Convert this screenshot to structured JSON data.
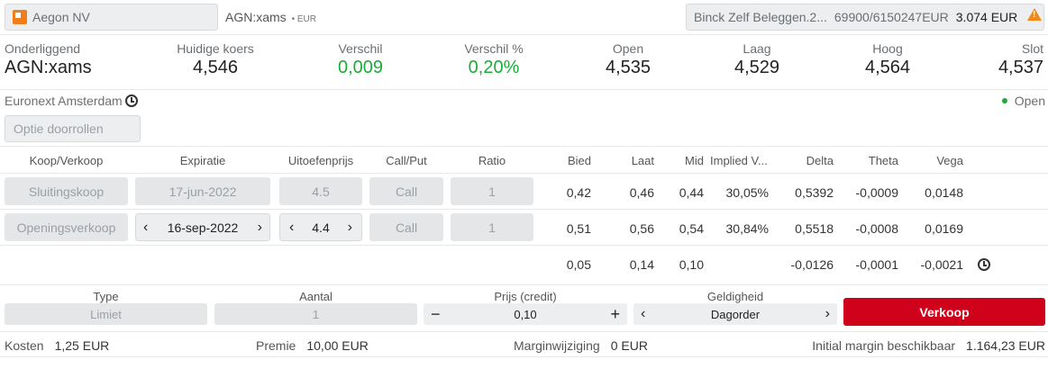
{
  "top": {
    "instrument": "Aegon NV",
    "symbol": "AGN:xams",
    "symbol_ccy": "• EUR",
    "account_name": "Binck Zelf Beleggen.2...",
    "account_no": "69900/6150247EUR",
    "account_amount": "3.074 EUR"
  },
  "quote": [
    {
      "label": "Onderliggend",
      "value": "AGN:xams",
      "color": "#222222"
    },
    {
      "label": "Huidige koers",
      "value": "4,546",
      "color": "#222222"
    },
    {
      "label": "Verschil",
      "value": "0,009",
      "color": "#1eab3a"
    },
    {
      "label": "Verschil %",
      "value": "0,20%",
      "color": "#1eab3a"
    },
    {
      "label": "Open",
      "value": "4,535",
      "color": "#222222"
    },
    {
      "label": "Laag",
      "value": "4,529",
      "color": "#222222"
    },
    {
      "label": "Hoog",
      "value": "4,564",
      "color": "#222222"
    },
    {
      "label": "Slot",
      "value": "4,537",
      "color": "#222222"
    }
  ],
  "exchange": "Euronext Amsterdam",
  "market_status": "Open",
  "rollover_label": "Optie doorrollen",
  "table": {
    "headers": [
      "Koop/Verkoop",
      "Expiratie",
      "Uitoefenprijs",
      "Call/Put",
      "Ratio",
      "Bied",
      "Laat",
      "Mid",
      "Implied V...",
      "Delta",
      "Theta",
      "Vega"
    ],
    "rows": [
      {
        "side": "Sluitingskoop",
        "expiry": "17-jun-2022",
        "strike": "4.5",
        "cp": "Call",
        "ratio": "1",
        "bid": "0,42",
        "last": "0,46",
        "mid": "0,44",
        "iv": "30,05%",
        "delta": "0,5392",
        "theta": "-0,0009",
        "vega": "0,0148"
      },
      {
        "side": "Openingsverkoop",
        "expiry": "16-sep-2022",
        "strike": "4.4",
        "cp": "Call",
        "ratio": "1",
        "bid": "0,51",
        "last": "0,56",
        "mid": "0,54",
        "iv": "30,84%",
        "delta": "0,5518",
        "theta": "-0,0008",
        "vega": "0,0169"
      }
    ],
    "totals": {
      "bid": "0,05",
      "last": "0,14",
      "mid": "0,10",
      "delta": "-0,0126",
      "theta": "-0,0001",
      "vega": "-0,0021"
    }
  },
  "order": {
    "type_label": "Type",
    "type_value": "Limiet",
    "qty_label": "Aantal",
    "qty_value": "1",
    "price_label": "Prijs (credit)",
    "price_value": "0,10",
    "validity_label": "Geldigheid",
    "validity_value": "Dagorder",
    "submit_label": "Verkoop"
  },
  "footer": {
    "costs_label": "Kosten",
    "costs_value": "1,25 EUR",
    "premium_label": "Premie",
    "premium_value": "10,00 EUR",
    "margin_change_label": "Marginwijziging",
    "margin_change_value": "0 EUR",
    "initial_margin_label": "Initial margin beschikbaar",
    "initial_margin_value": "1.164,23 EUR"
  },
  "colors": {
    "accent_sell": "#d0021b",
    "positive": "#1eab3a",
    "warning": "#f08a1c"
  }
}
